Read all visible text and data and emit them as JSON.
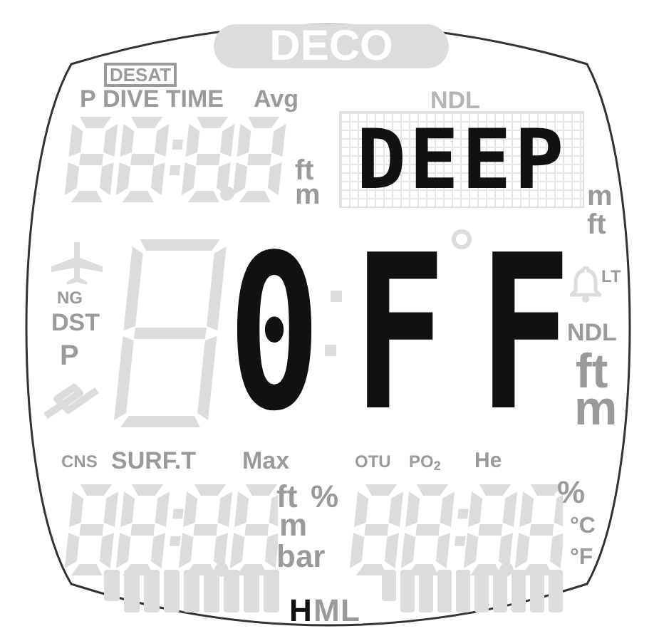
{
  "deco_badge": {
    "text": "DECO",
    "active": false
  },
  "labels": [
    {
      "text": "DESAT",
      "kind": "boxed",
      "active": false
    },
    {
      "text": "P",
      "kind": "plain",
      "active": false
    },
    {
      "text": "DIVE TIME",
      "kind": "plain",
      "active": false
    },
    {
      "text": "Avg",
      "kind": "plain",
      "active": false
    },
    {
      "text": "NDL",
      "kind": "faint",
      "active": false
    },
    {
      "text": "ft",
      "kind": "plain",
      "active": false
    },
    {
      "text": "m",
      "kind": "plain",
      "active": false
    },
    {
      "text": "m",
      "kind": "plain",
      "active": false
    },
    {
      "text": "ft",
      "kind": "plain",
      "active": false
    },
    {
      "text": "NG",
      "kind": "plain",
      "active": false
    },
    {
      "text": "DST",
      "kind": "plain",
      "active": false
    },
    {
      "text": "P",
      "kind": "plain",
      "active": false
    },
    {
      "text": "LT",
      "kind": "plain",
      "active": false
    },
    {
      "text": "NDL",
      "kind": "plain",
      "active": false
    },
    {
      "text": "ft",
      "kind": "plain",
      "active": false
    },
    {
      "text": "m",
      "kind": "plain",
      "active": false
    },
    {
      "text": "CNS",
      "kind": "plain",
      "active": false
    },
    {
      "text": "SURF.T",
      "kind": "plain",
      "active": false
    },
    {
      "text": "Max",
      "kind": "plain",
      "active": false
    },
    {
      "text": "OTU",
      "kind": "plain",
      "active": false
    },
    {
      "text": "PO$_{2}$",
      "kind": "plain",
      "active": false
    },
    {
      "text": "He",
      "kind": "plain",
      "active": false
    },
    {
      "text": "ft",
      "kind": "plain",
      "active": false
    },
    {
      "text": "%",
      "kind": "plain",
      "active": false
    },
    {
      "text": "m",
      "kind": "plain",
      "active": false
    },
    {
      "text": "bar",
      "kind": "plain",
      "active": false
    },
    {
      "text": "%",
      "kind": "plain",
      "active": false
    },
    {
      "text": "°C",
      "kind": "plain",
      "active": false
    },
    {
      "text": "°F",
      "kind": "plain",
      "active": false
    },
    {
      "text": "H",
      "kind": "plain",
      "active": true
    },
    {
      "text": "M",
      "kind": "plain",
      "active": false
    },
    {
      "text": "L",
      "kind": "plain",
      "active": false
    }
  ],
  "matrix_display": {
    "text": "DEEP"
  },
  "main_digits": [
    {
      "text": "0"
    },
    {
      "text": "F"
    },
    {
      "text": "F"
    }
  ]
}
